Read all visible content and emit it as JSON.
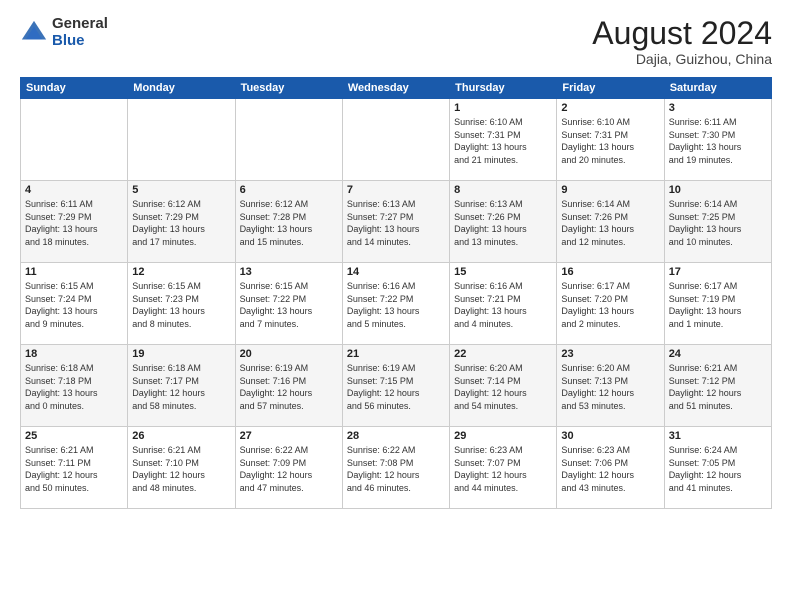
{
  "logo": {
    "general": "General",
    "blue": "Blue"
  },
  "header": {
    "month": "August 2024",
    "location": "Dajia, Guizhou, China"
  },
  "weekdays": [
    "Sunday",
    "Monday",
    "Tuesday",
    "Wednesday",
    "Thursday",
    "Friday",
    "Saturday"
  ],
  "weeks": [
    [
      {
        "day": "",
        "info": ""
      },
      {
        "day": "",
        "info": ""
      },
      {
        "day": "",
        "info": ""
      },
      {
        "day": "",
        "info": ""
      },
      {
        "day": "1",
        "info": "Sunrise: 6:10 AM\nSunset: 7:31 PM\nDaylight: 13 hours\nand 21 minutes."
      },
      {
        "day": "2",
        "info": "Sunrise: 6:10 AM\nSunset: 7:31 PM\nDaylight: 13 hours\nand 20 minutes."
      },
      {
        "day": "3",
        "info": "Sunrise: 6:11 AM\nSunset: 7:30 PM\nDaylight: 13 hours\nand 19 minutes."
      }
    ],
    [
      {
        "day": "4",
        "info": "Sunrise: 6:11 AM\nSunset: 7:29 PM\nDaylight: 13 hours\nand 18 minutes."
      },
      {
        "day": "5",
        "info": "Sunrise: 6:12 AM\nSunset: 7:29 PM\nDaylight: 13 hours\nand 17 minutes."
      },
      {
        "day": "6",
        "info": "Sunrise: 6:12 AM\nSunset: 7:28 PM\nDaylight: 13 hours\nand 15 minutes."
      },
      {
        "day": "7",
        "info": "Sunrise: 6:13 AM\nSunset: 7:27 PM\nDaylight: 13 hours\nand 14 minutes."
      },
      {
        "day": "8",
        "info": "Sunrise: 6:13 AM\nSunset: 7:26 PM\nDaylight: 13 hours\nand 13 minutes."
      },
      {
        "day": "9",
        "info": "Sunrise: 6:14 AM\nSunset: 7:26 PM\nDaylight: 13 hours\nand 12 minutes."
      },
      {
        "day": "10",
        "info": "Sunrise: 6:14 AM\nSunset: 7:25 PM\nDaylight: 13 hours\nand 10 minutes."
      }
    ],
    [
      {
        "day": "11",
        "info": "Sunrise: 6:15 AM\nSunset: 7:24 PM\nDaylight: 13 hours\nand 9 minutes."
      },
      {
        "day": "12",
        "info": "Sunrise: 6:15 AM\nSunset: 7:23 PM\nDaylight: 13 hours\nand 8 minutes."
      },
      {
        "day": "13",
        "info": "Sunrise: 6:15 AM\nSunset: 7:22 PM\nDaylight: 13 hours\nand 7 minutes."
      },
      {
        "day": "14",
        "info": "Sunrise: 6:16 AM\nSunset: 7:22 PM\nDaylight: 13 hours\nand 5 minutes."
      },
      {
        "day": "15",
        "info": "Sunrise: 6:16 AM\nSunset: 7:21 PM\nDaylight: 13 hours\nand 4 minutes."
      },
      {
        "day": "16",
        "info": "Sunrise: 6:17 AM\nSunset: 7:20 PM\nDaylight: 13 hours\nand 2 minutes."
      },
      {
        "day": "17",
        "info": "Sunrise: 6:17 AM\nSunset: 7:19 PM\nDaylight: 13 hours\nand 1 minute."
      }
    ],
    [
      {
        "day": "18",
        "info": "Sunrise: 6:18 AM\nSunset: 7:18 PM\nDaylight: 13 hours\nand 0 minutes."
      },
      {
        "day": "19",
        "info": "Sunrise: 6:18 AM\nSunset: 7:17 PM\nDaylight: 12 hours\nand 58 minutes."
      },
      {
        "day": "20",
        "info": "Sunrise: 6:19 AM\nSunset: 7:16 PM\nDaylight: 12 hours\nand 57 minutes."
      },
      {
        "day": "21",
        "info": "Sunrise: 6:19 AM\nSunset: 7:15 PM\nDaylight: 12 hours\nand 56 minutes."
      },
      {
        "day": "22",
        "info": "Sunrise: 6:20 AM\nSunset: 7:14 PM\nDaylight: 12 hours\nand 54 minutes."
      },
      {
        "day": "23",
        "info": "Sunrise: 6:20 AM\nSunset: 7:13 PM\nDaylight: 12 hours\nand 53 minutes."
      },
      {
        "day": "24",
        "info": "Sunrise: 6:21 AM\nSunset: 7:12 PM\nDaylight: 12 hours\nand 51 minutes."
      }
    ],
    [
      {
        "day": "25",
        "info": "Sunrise: 6:21 AM\nSunset: 7:11 PM\nDaylight: 12 hours\nand 50 minutes."
      },
      {
        "day": "26",
        "info": "Sunrise: 6:21 AM\nSunset: 7:10 PM\nDaylight: 12 hours\nand 48 minutes."
      },
      {
        "day": "27",
        "info": "Sunrise: 6:22 AM\nSunset: 7:09 PM\nDaylight: 12 hours\nand 47 minutes."
      },
      {
        "day": "28",
        "info": "Sunrise: 6:22 AM\nSunset: 7:08 PM\nDaylight: 12 hours\nand 46 minutes."
      },
      {
        "day": "29",
        "info": "Sunrise: 6:23 AM\nSunset: 7:07 PM\nDaylight: 12 hours\nand 44 minutes."
      },
      {
        "day": "30",
        "info": "Sunrise: 6:23 AM\nSunset: 7:06 PM\nDaylight: 12 hours\nand 43 minutes."
      },
      {
        "day": "31",
        "info": "Sunrise: 6:24 AM\nSunset: 7:05 PM\nDaylight: 12 hours\nand 41 minutes."
      }
    ]
  ]
}
